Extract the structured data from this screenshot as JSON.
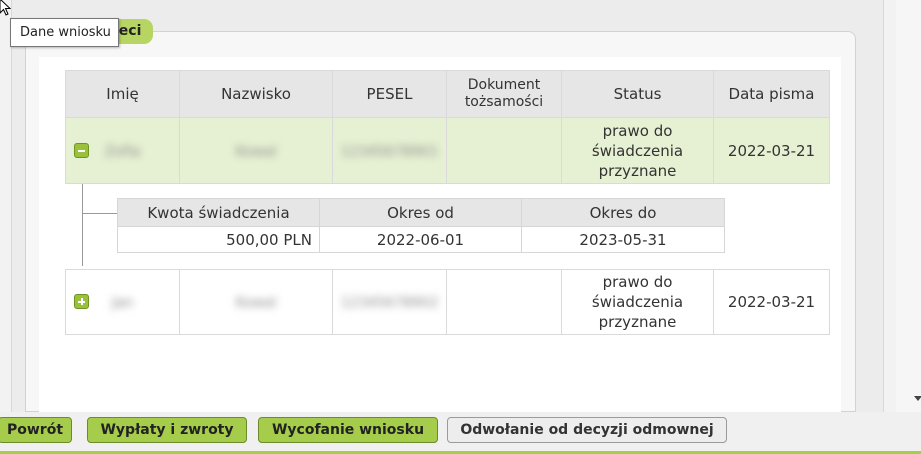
{
  "tooltip": {
    "text": "Dane wniosku"
  },
  "section": {
    "title_visible": "ieci"
  },
  "table": {
    "headers": [
      "Imię",
      "Nazwisko",
      "PESEL",
      "Dokument tożsamości",
      "Status",
      "Data pisma"
    ],
    "rows": [
      {
        "first_name": "Zofia",
        "last_name": "Kowal",
        "pesel": "12345678901",
        "document": "",
        "status": "prawo do świadczenia przyznane",
        "date": "2022-03-21",
        "expanded": true
      },
      {
        "first_name": "Jan",
        "last_name": "Kowal",
        "pesel": "12345678902",
        "document": "",
        "status": "prawo do świadczenia przyznane",
        "date": "2022-03-21",
        "expanded": false
      }
    ]
  },
  "detail": {
    "headers": [
      "Kwota świadczenia",
      "Okres od",
      "Okres do"
    ],
    "row": {
      "amount": "500,00 PLN",
      "from": "2022-06-01",
      "to": "2023-05-31"
    }
  },
  "buttons": {
    "back": "Powrót",
    "payments": "Wypłaty i zwroty",
    "withdraw": "Wycofanie wniosku",
    "appeal": "Odwołanie od decyzji odmownej"
  },
  "colors": {
    "accent": "#a6cc4b",
    "row_highlight": "#e6f1d3",
    "header_bg": "#e6e6e6"
  }
}
